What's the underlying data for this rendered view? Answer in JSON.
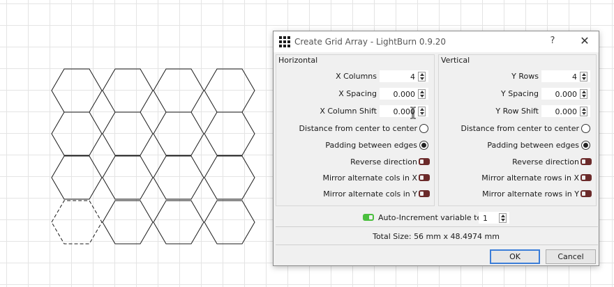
{
  "dialog": {
    "title": "Create Grid Array - LightBurn 0.9.20",
    "help": "?",
    "close": "✕",
    "horizontal": {
      "title": "Horizontal",
      "x_columns_label": "X Columns",
      "x_columns": "4",
      "x_spacing_label": "X Spacing",
      "x_spacing": "0.000",
      "x_column_shift_label": "X Column Shift",
      "x_column_shift": "0.000",
      "center_label": "Distance from center to center",
      "center_selected": false,
      "padding_label": "Padding between edges",
      "padding_selected": true,
      "reverse_label": "Reverse direction",
      "reverse": false,
      "mirror_x_label": "Mirror alternate cols in X",
      "mirror_x": false,
      "mirror_y_label": "Mirror alternate cols in Y",
      "mirror_y": false
    },
    "vertical": {
      "title": "Vertical",
      "y_rows_label": "Y Rows",
      "y_rows": "4",
      "y_spacing_label": "Y Spacing",
      "y_spacing": "0.000",
      "y_row_shift_label": "Y Row Shift",
      "y_row_shift": "0.000",
      "center_label": "Distance from center to center",
      "center_selected": false,
      "padding_label": "Padding between edges",
      "padding_selected": true,
      "reverse_label": "Reverse direction",
      "reverse": false,
      "mirror_x_label": "Mirror alternate rows in X",
      "mirror_x": false,
      "mirror_y_label": "Mirror alternate rows in Y",
      "mirror_y": false
    },
    "auto_increment_label": "Auto-Increment variable text",
    "auto_increment_enabled": true,
    "auto_increment_value": "1",
    "total_size": "Total Size: 56 mm x 48.4974 mm",
    "ok": "OK",
    "cancel": "Cancel"
  },
  "colors": {
    "toggle_off": "#6b2a2a",
    "toggle_on": "#4bbf3f",
    "ok_focus": "#3b7dd8"
  },
  "canvas": {
    "columns": 4,
    "rows": 4,
    "shape": "hexagon",
    "selected_cell": "bottom-left"
  }
}
